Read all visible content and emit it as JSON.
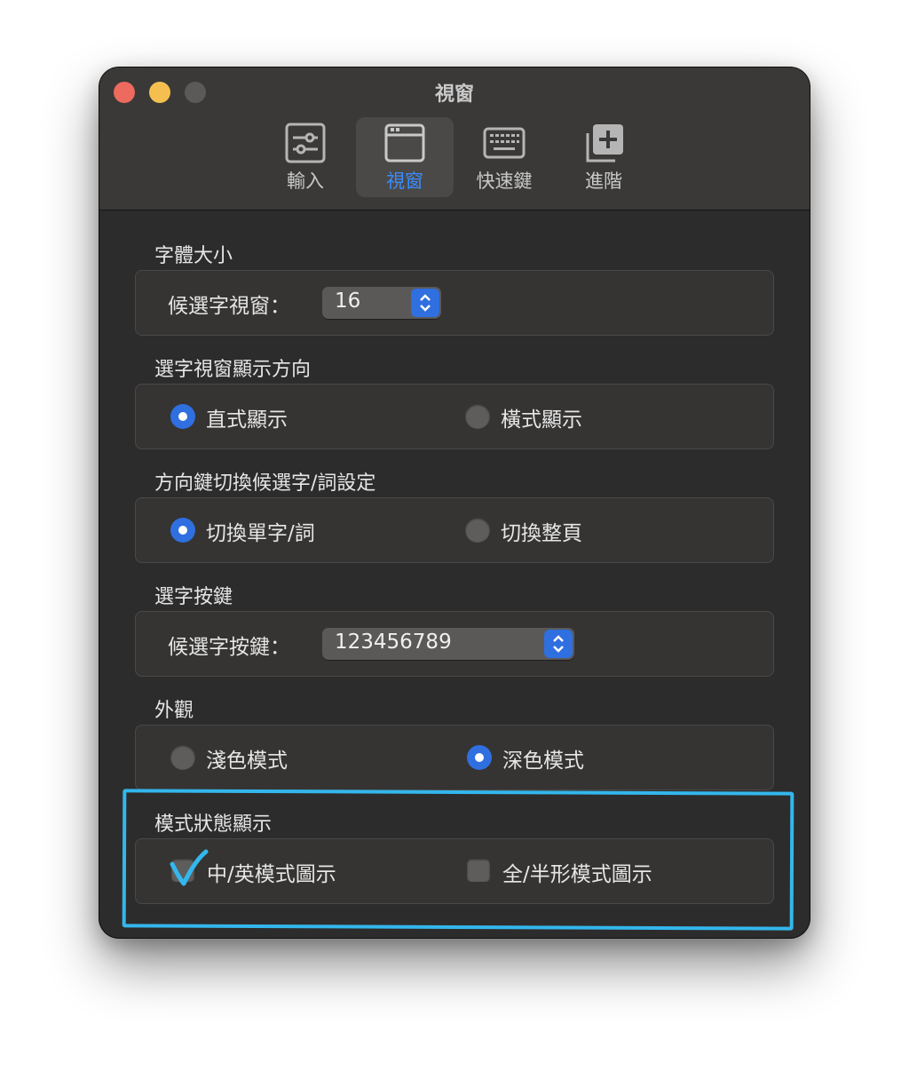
{
  "window": {
    "title": "視窗",
    "colors": {
      "background": "#2d2c2c",
      "accent": "#2f6fe0",
      "selected_tab_text": "#3b8cff",
      "annotation": "#33b7ec"
    }
  },
  "toolbar": {
    "tabs": [
      {
        "label": "輸入",
        "icon": "sliders-icon",
        "selected": false
      },
      {
        "label": "視窗",
        "icon": "window-icon",
        "selected": true
      },
      {
        "label": "快速鍵",
        "icon": "keyboard-icon",
        "selected": false
      },
      {
        "label": "進階",
        "icon": "add-squares-icon",
        "selected": false
      }
    ]
  },
  "sections": {
    "font_size": {
      "title": "字體大小",
      "label": "候選字視窗：",
      "value": "16"
    },
    "orientation": {
      "title": "選字視窗顯示方向",
      "options": [
        {
          "label": "直式顯示",
          "selected": true
        },
        {
          "label": "橫式顯示",
          "selected": false
        }
      ]
    },
    "arrow_keys": {
      "title": "方向鍵切換候選字/詞設定",
      "options": [
        {
          "label": "切換單字/詞",
          "selected": true
        },
        {
          "label": "切換整頁",
          "selected": false
        }
      ]
    },
    "select_keys": {
      "title": "選字按鍵",
      "label": "候選字按鍵：",
      "value": "123456789"
    },
    "appearance": {
      "title": "外觀",
      "options": [
        {
          "label": "淺色模式",
          "selected": false
        },
        {
          "label": "深色模式",
          "selected": true
        }
      ]
    },
    "mode_status": {
      "title": "模式狀態顯示",
      "options": [
        {
          "label": "中/英模式圖示",
          "checked": true
        },
        {
          "label": "全/半形模式圖示",
          "checked": false
        }
      ]
    }
  }
}
